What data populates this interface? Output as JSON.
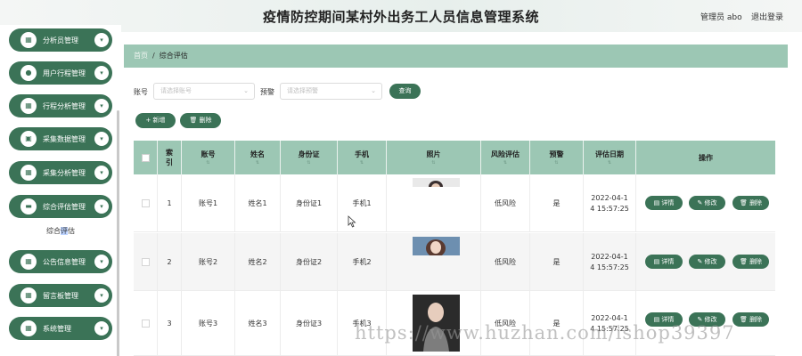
{
  "header": {
    "title": "疫情防控期间某村外出务工人员信息管理系统",
    "user": "管理员 abo",
    "logout": "退出登录"
  },
  "sidebar": {
    "items": [
      {
        "label": "分析员管理"
      },
      {
        "label": "用户行程管理"
      },
      {
        "label": "行程分析管理"
      },
      {
        "label": "采集数据管理"
      },
      {
        "label": "采集分析管理"
      },
      {
        "label": "综合评估管理"
      },
      {
        "label": "公告信息管理"
      },
      {
        "label": "留言板管理"
      },
      {
        "label": "系统管理"
      }
    ],
    "submenu": {
      "pre": "综合",
      "hl": "评",
      "post": "估"
    }
  },
  "breadcrumb": {
    "home": "首页",
    "sep": "/",
    "current": "综合评估"
  },
  "search": {
    "account_label": "账号",
    "account_placeholder": "请选择账号",
    "alert_label": "预警",
    "alert_placeholder": "请选择预警",
    "query": "查询"
  },
  "toolbar": {
    "add": "+ 新增",
    "delete": "删除"
  },
  "table": {
    "headers": {
      "index": "索引",
      "account": "账号",
      "name": "姓名",
      "id_card": "身份证",
      "phone": "手机",
      "photo": "照片",
      "risk": "风险评估",
      "alert": "预警",
      "date": "评估日期",
      "ops": "操作"
    },
    "rows": [
      {
        "index": "1",
        "account": "账号1",
        "name": "姓名1",
        "id_card": "身份证1",
        "phone": "手机1",
        "risk": "低风险",
        "alert": "是",
        "date_l1": "2022-04-1",
        "date_l2": "4 15:57:25"
      },
      {
        "index": "2",
        "account": "账号2",
        "name": "姓名2",
        "id_card": "身份证2",
        "phone": "手机2",
        "risk": "低风险",
        "alert": "是",
        "date_l1": "2022-04-1",
        "date_l2": "4 15:57:25"
      },
      {
        "index": "3",
        "account": "账号3",
        "name": "姓名3",
        "id_card": "身份证3",
        "phone": "手机3",
        "risk": "低风险",
        "alert": "是",
        "date_l1": "2022-04-1",
        "date_l2": "4 15:57:25"
      }
    ],
    "ops": {
      "detail": "详情",
      "edit": "修改",
      "delete": "删除"
    }
  },
  "watermark": "https://www.huzhan.com/ishop39397",
  "colors": {
    "primary": "#3b7357",
    "header_bg": "#9cc7b4"
  }
}
